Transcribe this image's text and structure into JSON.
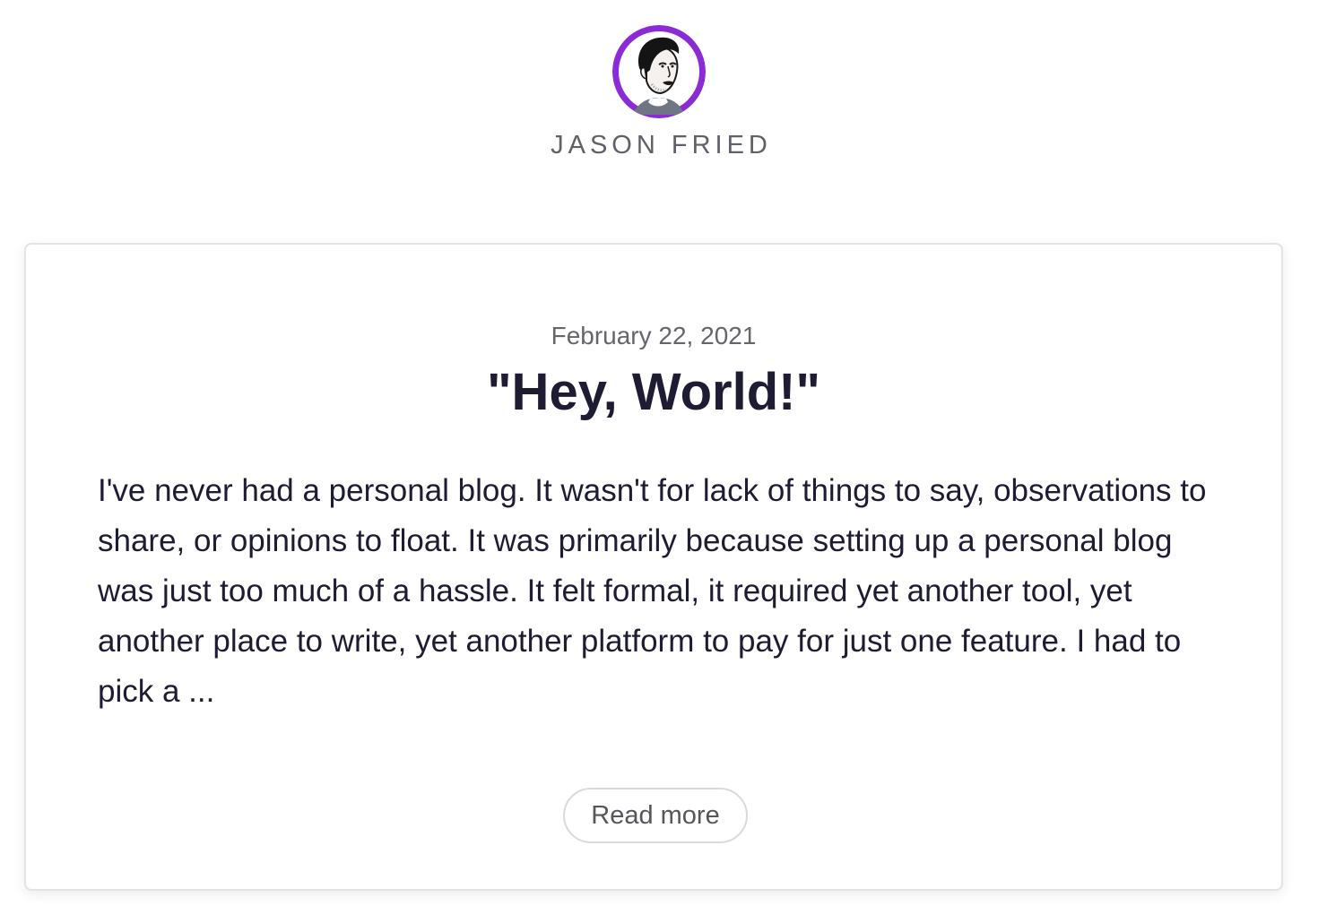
{
  "header": {
    "avatar_icon": "author-portrait-icon",
    "author_name": "JASON FRIED",
    "avatar_ring_color": "#8a2bd6"
  },
  "post": {
    "date": "February 22, 2021",
    "title": "\"Hey, World!\"",
    "excerpt": "I've never had a personal blog. It wasn't for lack of things to say, observations to share, or opinions to float. It was primarily because setting up a personal blog was just too much of a hassle. It felt formal, it required yet another tool, yet another place to write, yet another platform to pay for just one feature. I had to pick a ...",
    "read_more_label": "Read more"
  }
}
